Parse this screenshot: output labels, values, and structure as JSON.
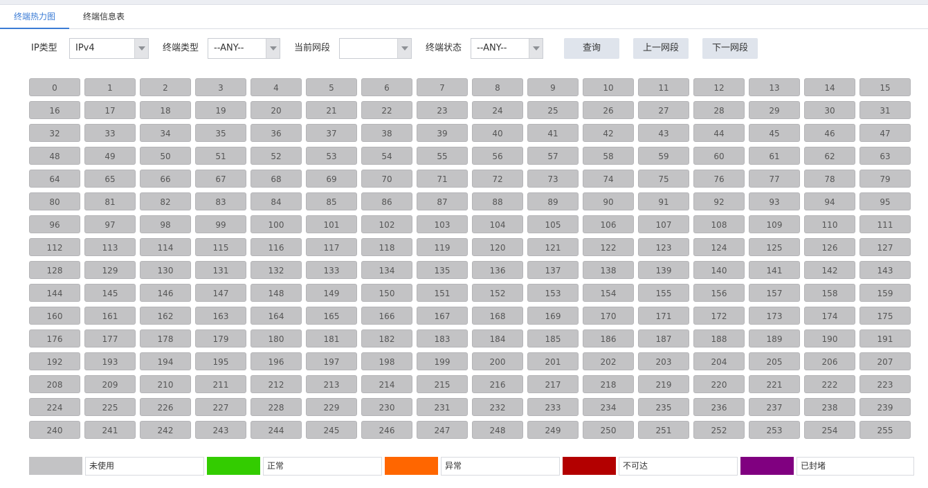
{
  "tabs": [
    {
      "label": "终端热力图",
      "active": true
    },
    {
      "label": "终端信息表",
      "active": false
    }
  ],
  "filters": {
    "ip_type": {
      "label": "IP类型",
      "value": "IPv4"
    },
    "terminal_type": {
      "label": "终端类型",
      "value": "--ANY--"
    },
    "current_segment": {
      "label": "当前网段",
      "value": ""
    },
    "terminal_status": {
      "label": "终端状态",
      "value": "--ANY--"
    }
  },
  "buttons": {
    "query": "查询",
    "prev_segment": "上一网段",
    "next_segment": "下一网段"
  },
  "grid": {
    "count": 256,
    "cell_color": "#c3c3c5"
  },
  "legend": [
    {
      "label": "未使用",
      "color": "#c3c3c5"
    },
    {
      "label": "正常",
      "color": "#33cc00"
    },
    {
      "label": "异常",
      "color": "#ff6600"
    },
    {
      "label": "不可达",
      "color": "#b30000"
    },
    {
      "label": "已封堵",
      "color": "#800080"
    }
  ]
}
